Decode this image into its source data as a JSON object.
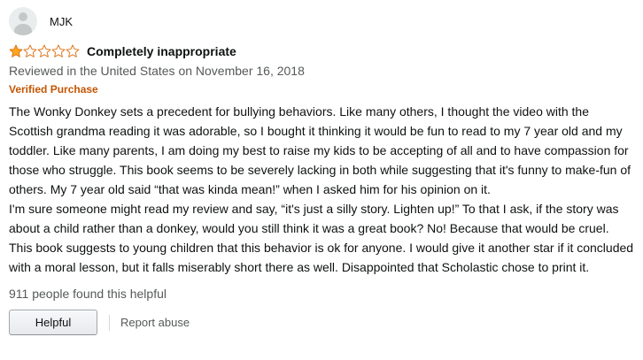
{
  "review": {
    "author": "MJK",
    "rating": 1,
    "rating_max": 5,
    "title": "Completely inappropriate",
    "reviewed_line": "Reviewed in the United States on November 16, 2018",
    "verified_label": "Verified Purchase",
    "paragraphs": [
      "The Wonky Donkey sets a precedent for bullying behaviors. Like many others, I thought the video with the Scottish grandma reading it was adorable, so I bought it thinking it would be fun to read to my 7 year old and my toddler. Like many parents, I am doing my best to raise my kids to be accepting of all and to have compassion for those who struggle. This book seems to be severely lacking in both while suggesting that it's funny to make-fun of others. My 7 year old said “that was kinda mean!” when I asked him for his opinion on it.",
      "I'm sure someone might read my review and say, “it's just a silly story. Lighten up!” To that I ask, if the story was about a child rather than a donkey, would you still think it was a great book? No! Because that would be cruel. This book suggests to young children that this behavior is ok for anyone. I would give it another star if it concluded with a moral lesson, but it falls miserably short there as well. Disappointed that Scholastic chose to print it."
    ],
    "helpful_count_text": "911 people found this helpful",
    "helpful_button": "Helpful",
    "report_link": "Report abuse"
  },
  "colors": {
    "star_fill": "#ffa41c",
    "star_stroke": "#de7921",
    "verified": "#c45500",
    "secondary_text": "#565959"
  },
  "icons": {
    "avatar": "default-avatar-icon",
    "star_filled": "star-filled-icon",
    "star_empty": "star-empty-icon"
  }
}
